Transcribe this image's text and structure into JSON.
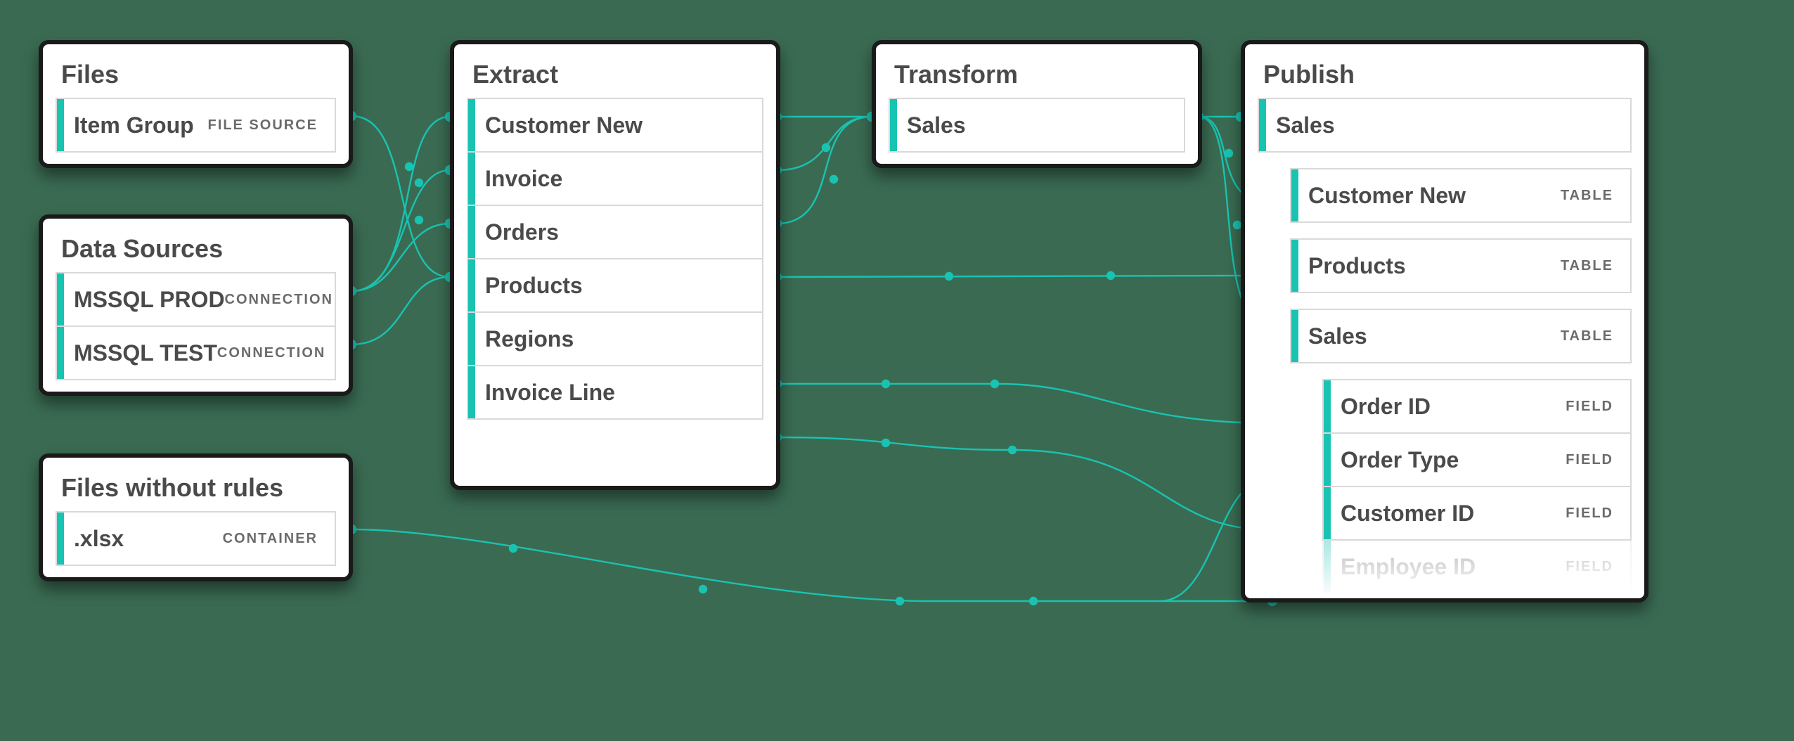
{
  "colors": {
    "background": "#3a6b52",
    "panel_border": "#1a1a1a",
    "accent": "#19c3b2",
    "line": "#19c3b2",
    "row_border": "#d9d9d9",
    "text": "#4a4a4a",
    "tag_text": "#6b6b6b"
  },
  "panels": {
    "files": {
      "title": "Files",
      "items": [
        {
          "label": "Item Group",
          "tag": "FILE SOURCE"
        }
      ]
    },
    "data_sources": {
      "title": "Data Sources",
      "items": [
        {
          "label": "MSSQL PROD",
          "tag": "CONNECTION"
        },
        {
          "label": "MSSQL TEST",
          "tag": "CONNECTION"
        }
      ]
    },
    "files_without_rules": {
      "title": "Files without rules",
      "items": [
        {
          "label": ".xlsx",
          "tag": "CONTAINER"
        }
      ]
    },
    "extract": {
      "title": "Extract",
      "items": [
        {
          "label": "Customer New"
        },
        {
          "label": "Invoice"
        },
        {
          "label": "Orders"
        },
        {
          "label": "Products"
        },
        {
          "label": "Regions"
        },
        {
          "label": "Invoice Line"
        }
      ]
    },
    "transform": {
      "title": "Transform",
      "items": [
        {
          "label": "Sales"
        }
      ]
    },
    "publish": {
      "title": "Publish",
      "items": [
        {
          "label": "Sales",
          "indent": 0
        },
        {
          "label": "Customer New",
          "tag": "TABLE",
          "indent": 1
        },
        {
          "label": "Products",
          "tag": "TABLE",
          "indent": 1
        },
        {
          "label": "Sales",
          "tag": "TABLE",
          "indent": 1
        },
        {
          "label": "Order ID",
          "tag": "FIELD",
          "indent": 2
        },
        {
          "label": "Order Type",
          "tag": "FIELD",
          "indent": 2
        },
        {
          "label": "Customer ID",
          "tag": "FIELD",
          "indent": 2
        },
        {
          "label": "Employee ID",
          "tag": "FIELD",
          "indent": 2
        }
      ]
    }
  },
  "connections": [
    {
      "from": "files.0",
      "to": "extract.3"
    },
    {
      "from": "data_sources.0",
      "to": "extract.0"
    },
    {
      "from": "data_sources.0",
      "to": "extract.1"
    },
    {
      "from": "data_sources.0",
      "to": "extract.2"
    },
    {
      "from": "data_sources.1",
      "to": "extract.3"
    },
    {
      "from": "extract.0",
      "to": "transform.0"
    },
    {
      "from": "extract.1",
      "to": "transform.0"
    },
    {
      "from": "extract.2",
      "to": "transform.0"
    },
    {
      "from": "extract.3",
      "to": "publish.2"
    },
    {
      "from": "extract.4",
      "to": "publish.4"
    },
    {
      "from": "extract.5",
      "to": "publish.6"
    },
    {
      "from": "transform.0",
      "to": "publish.0"
    },
    {
      "from": "transform.0",
      "to": "publish.1"
    },
    {
      "from": "transform.0",
      "to": "publish.3"
    },
    {
      "from": "files_without_rules.0",
      "to": "publish.5"
    }
  ]
}
